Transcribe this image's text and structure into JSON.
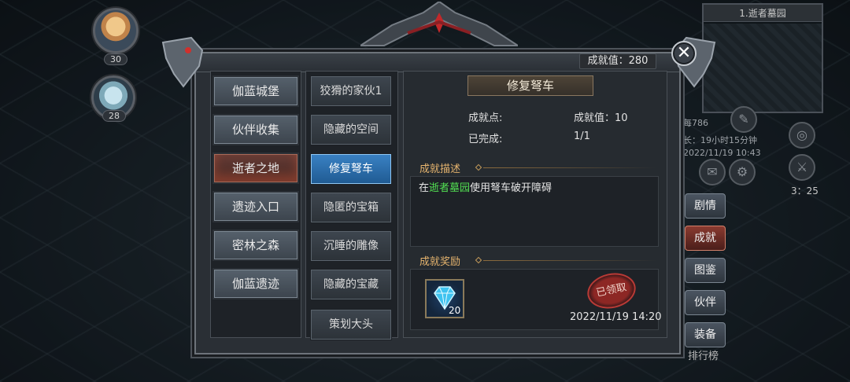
{
  "hud": {
    "avatar1_level": "30",
    "avatar2_level": "28",
    "minimap_title": "1.逝者墓园",
    "right_info": [
      "每786",
      "长：19小时15分钟",
      "2022/11/19 10:43"
    ],
    "time_small": "3：25",
    "side_menu": [
      "剧情",
      "成就",
      "图鉴",
      "伙伴",
      "装备"
    ],
    "rank_label": "排行榜"
  },
  "dialog": {
    "score_label": "成就值：280",
    "close_symbol": "✕",
    "categories": [
      "伽蓝城堡",
      "伙伴收集",
      "逝者之地",
      "遗迹入口",
      "密林之森",
      "伽蓝遗迹"
    ],
    "active_category": "逝者之地",
    "achievements": [
      "狡猾的家伙1",
      "隐藏的空间",
      "修复弩车",
      "隐匿的宝箱",
      "沉睡的雕像",
      "隐藏的宝藏",
      "策划大头"
    ],
    "active_achievement": "修复弩车",
    "detail": {
      "title": "修复弩车",
      "points_label": "成就点:",
      "points_value": "成就值：10",
      "done_label": "已完成:",
      "done_value": "1/1",
      "desc_title": "成就描述",
      "desc_prefix": "在",
      "desc_highlight": "逝者墓园",
      "desc_suffix": "使用弩车破开障碍",
      "reward_title": "成就奖励",
      "reward_count": "20",
      "claimed_stamp": "已领取",
      "claimed_date": "2022/11/19 14:20"
    }
  },
  "colors": {
    "accent_blue": "#2f78b8",
    "active_red": "#6a3d36",
    "section_gold": "#e6b46e",
    "highlight_green": "#52e052"
  }
}
